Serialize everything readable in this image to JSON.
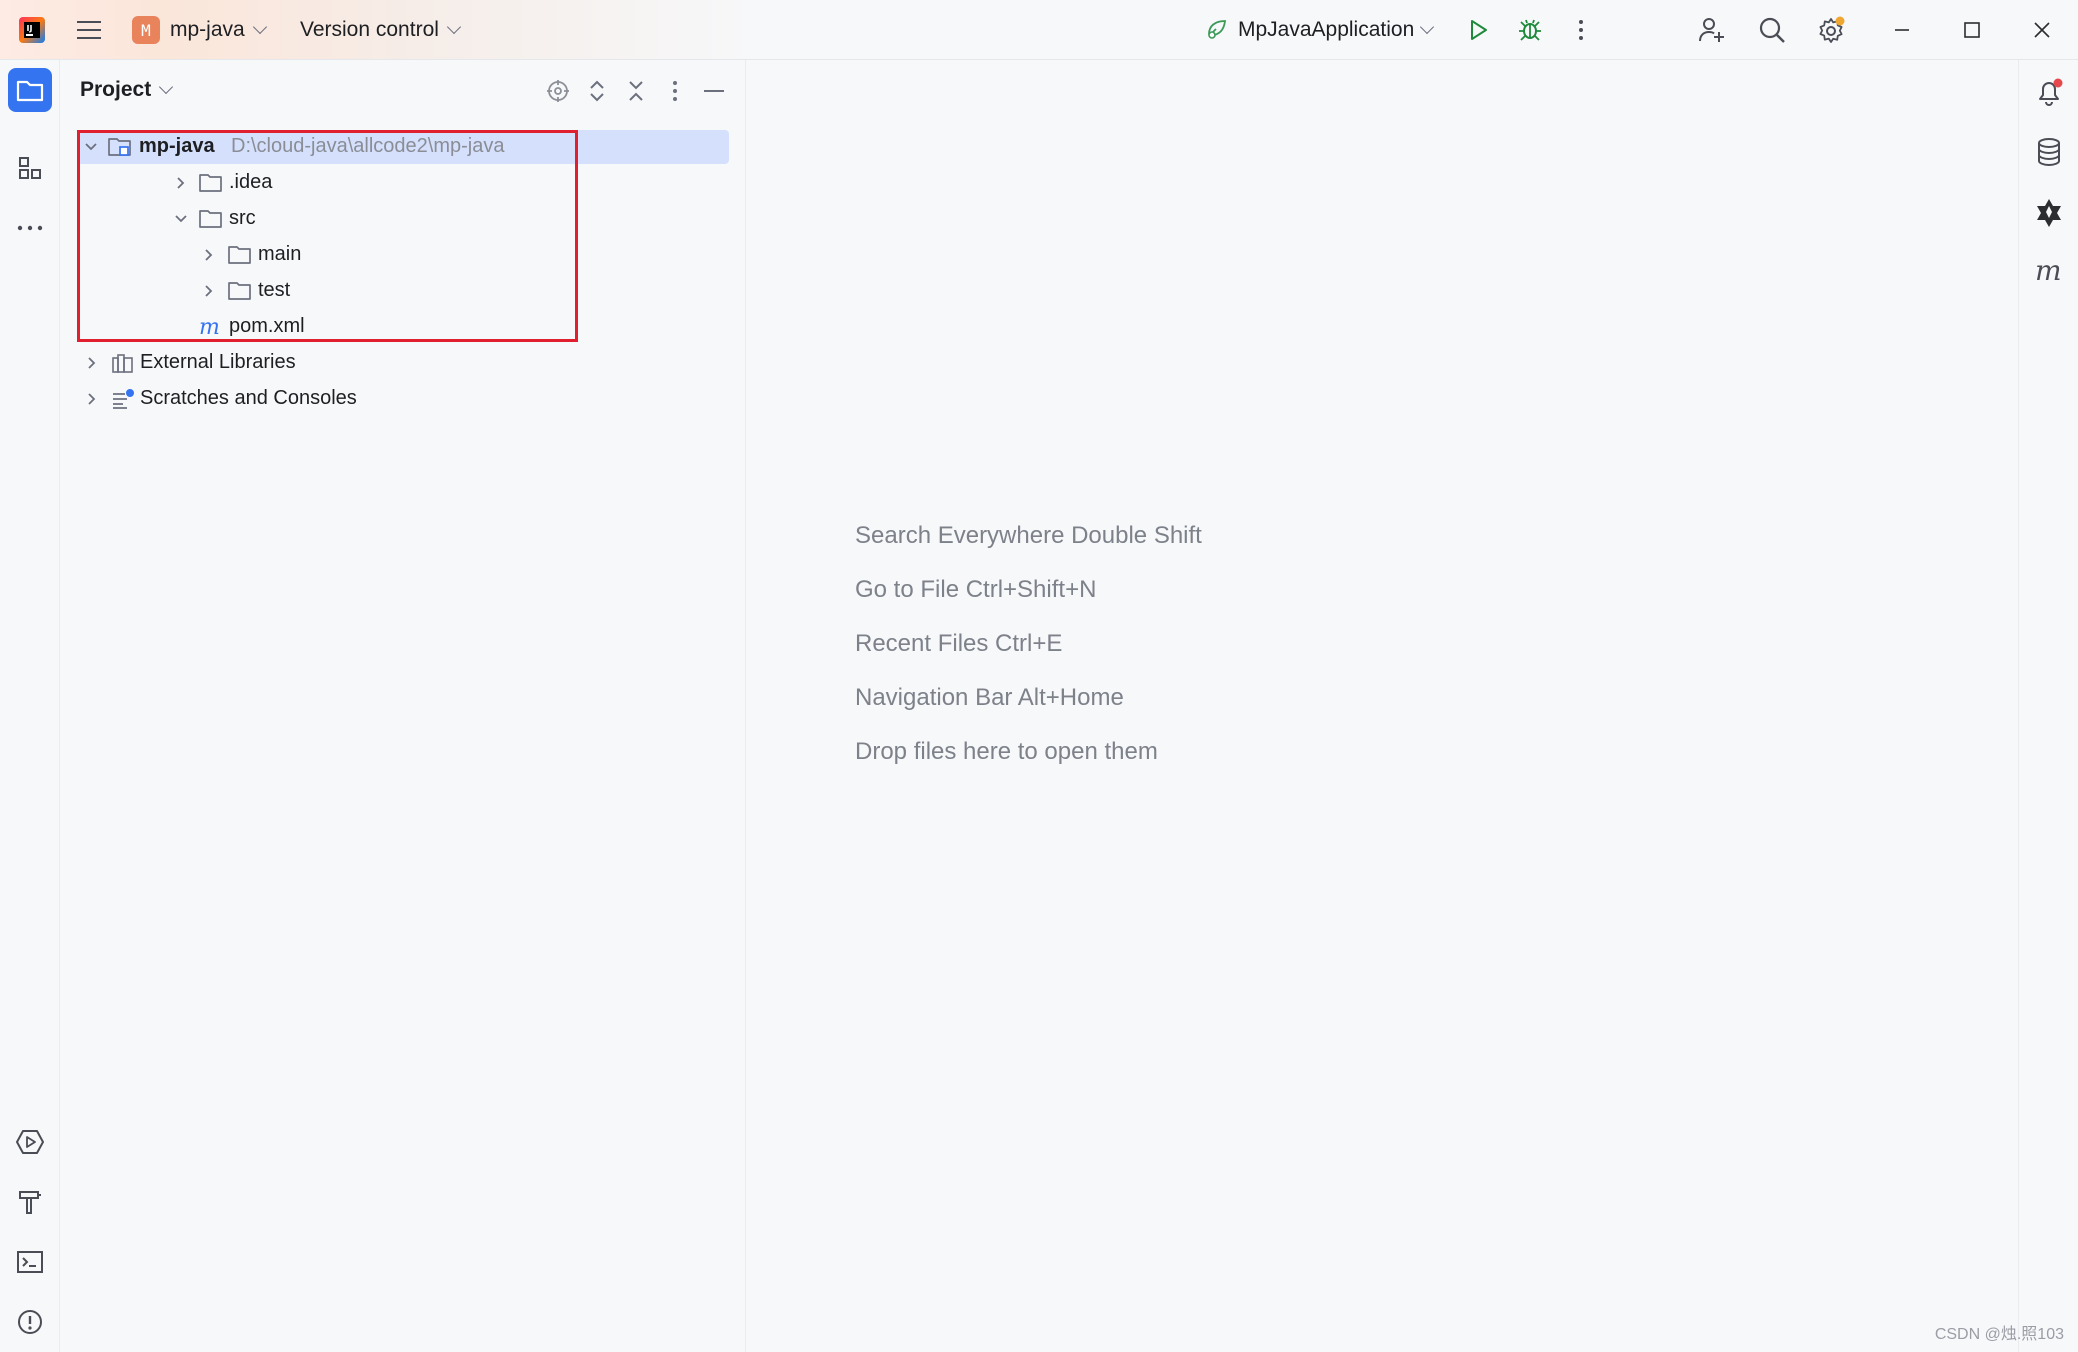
{
  "titlebar": {
    "project_badge": "M",
    "project_name": "mp-java",
    "vcs_label": "Version control",
    "run_config": "MpJavaApplication"
  },
  "panel": {
    "title": "Project"
  },
  "tree": [
    {
      "label": "mp-java",
      "path": "D:\\cloud-java\\allcode2\\mp-java",
      "icon": "module-folder-icon",
      "expanded": true,
      "bold": true
    },
    {
      "label": ".idea",
      "icon": "folder-icon",
      "expanded": false
    },
    {
      "label": "src",
      "icon": "folder-icon",
      "expanded": true
    },
    {
      "label": "main",
      "icon": "folder-icon",
      "expanded": false
    },
    {
      "label": "test",
      "icon": "folder-icon",
      "expanded": false
    },
    {
      "label": "pom.xml",
      "icon": "maven-file-icon"
    },
    {
      "label": "External Libraries",
      "icon": "library-icon",
      "expanded": false
    },
    {
      "label": "Scratches and Consoles",
      "icon": "scratches-icon",
      "expanded": false
    }
  ],
  "editor_hints": [
    "Search Everywhere Double Shift",
    "Go to File Ctrl+Shift+N",
    "Recent Files Ctrl+E",
    "Navigation Bar Alt+Home",
    "Drop files here to open them"
  ],
  "watermark": "CSDN @烛.照103",
  "colors": {
    "accent": "#3574f0",
    "selection": "#d5e1fc",
    "highlight_box": "#e0202f",
    "run_green": "#208a3c",
    "project_badge": "#e8835b"
  }
}
